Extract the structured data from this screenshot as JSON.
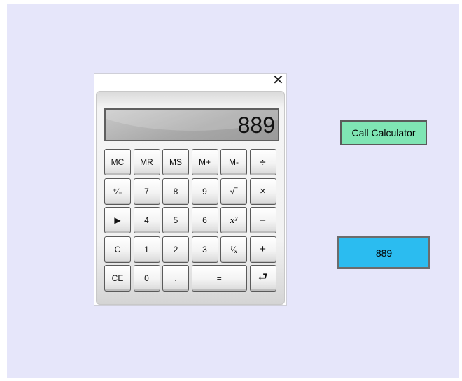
{
  "calculator": {
    "close_icon": "close-icon",
    "display_value": "889",
    "keys": [
      {
        "id": "mc",
        "label": "MC"
      },
      {
        "id": "mr",
        "label": "MR"
      },
      {
        "id": "ms",
        "label": "MS"
      },
      {
        "id": "mplus",
        "label": "M+"
      },
      {
        "id": "mminus",
        "label": "M-"
      },
      {
        "id": "divide",
        "label": "÷"
      },
      {
        "id": "negate",
        "label": "⁺∕₋"
      },
      {
        "id": "7",
        "label": "7"
      },
      {
        "id": "8",
        "label": "8"
      },
      {
        "id": "9",
        "label": "9"
      },
      {
        "id": "sqrt",
        "label": "√‾"
      },
      {
        "id": "multiply",
        "label": "×"
      },
      {
        "id": "play",
        "label": "▶"
      },
      {
        "id": "4",
        "label": "4"
      },
      {
        "id": "5",
        "label": "5"
      },
      {
        "id": "6",
        "label": "6"
      },
      {
        "id": "square",
        "label": "x²"
      },
      {
        "id": "subtract",
        "label": "−"
      },
      {
        "id": "clear",
        "label": "C"
      },
      {
        "id": "1",
        "label": "1"
      },
      {
        "id": "2",
        "label": "2"
      },
      {
        "id": "3",
        "label": "3"
      },
      {
        "id": "reciprocal",
        "label": "¹∕ₓ"
      },
      {
        "id": "add",
        "label": "+"
      },
      {
        "id": "clear_entry",
        "label": "CE"
      },
      {
        "id": "0",
        "label": "0"
      },
      {
        "id": "decimal",
        "label": "."
      },
      {
        "id": "equals",
        "label": "="
      },
      {
        "id": "enter",
        "label": "⮐"
      }
    ]
  },
  "actions": {
    "call_calculator_label": "Call Calculator",
    "result_value": "889"
  },
  "colors": {
    "stage_background": "#e6e6fa",
    "call_button": "#7fe5b4",
    "result_box": "#2bbcf0"
  }
}
